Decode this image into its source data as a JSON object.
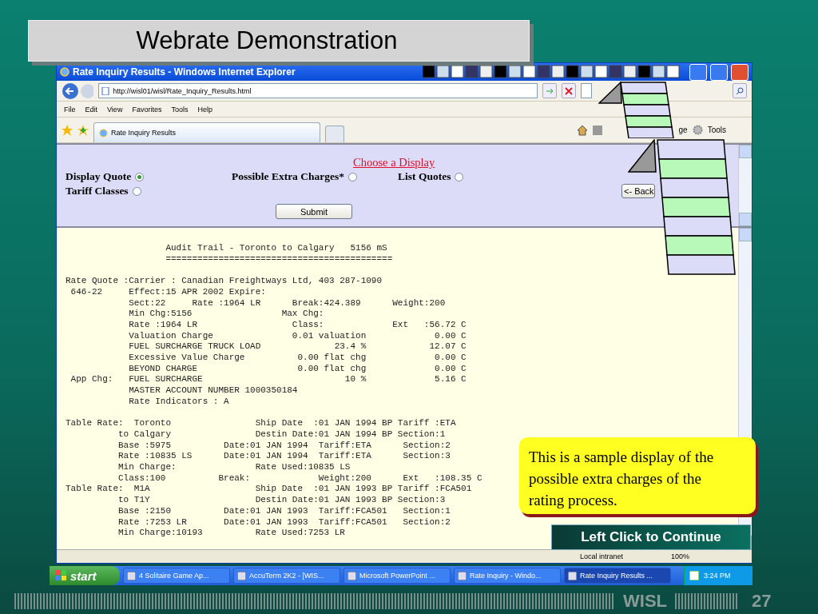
{
  "slide_title": "Webrate Demonstration",
  "browser": {
    "title": "Rate Inquiry Results - Windows Internet Explorer",
    "address": "http://wisl01/wisl/Rate_Inquiry_Results.html",
    "menu": [
      "File",
      "Edit",
      "View",
      "Favorites",
      "Tools",
      "Help"
    ],
    "tab": "Rate Inquiry Results",
    "page_menu": "ge",
    "tools_menu": "Tools",
    "status": [
      "Local intranet",
      "100%"
    ]
  },
  "display_form": {
    "heading": "Choose a Display",
    "options": [
      {
        "label": "Display Quote",
        "selected": true
      },
      {
        "label": "Possible Extra Charges*",
        "selected": false
      },
      {
        "label": "List Quotes",
        "selected": false
      },
      {
        "label": "Tariff Classes",
        "selected": false
      }
    ],
    "submit": "Submit",
    "back": "<- Back"
  },
  "audit_blocks": [
    [
      "                   Audit Trail - Toronto to Calgary   5156 mS",
      "                   ==========================================="
    ],
    [
      "Rate Quote :Carrier : Canadian Freightways Ltd, 403 287-1090",
      " 646-22     Effect:15 APR 2002 Expire:",
      "            Sect:22     Rate :1964 LR      Break:424.389      Weight:200",
      "            Min Chg:5156                 Max Chg:",
      "            Rate :1964 LR                  Class:             Ext   :56.72 C",
      "            Valuation Charge               0.01 valuation             0.00 C",
      "            FUEL SURCHARGE TRUCK LOAD              23.4 %            12.07 C",
      "            Excessive Value Charge          0.00 flat chg             0.00 C",
      "            BEYOND CHARGE                   0.00 flat chg             0.00 C",
      " App Chg:   FUEL SURCHARGE                           10 %             5.16 C",
      "            MASTER ACCOUNT NUMBER 1000350184",
      "            Rate Indicators : A"
    ],
    [
      "Table Rate:  Toronto                Ship Date  :01 JAN 1994 BP Tariff :ETA",
      "          to Calgary                Destin Date:01 JAN 1994 BP Section:1",
      "          Base :5975          Date:01 JAN 1994  Tariff:ETA      Section:2",
      "          Rate :10835 LS      Date:01 JAN 1994  Tariff:ETA      Section:3",
      "          Min Charge:               Rate Used:10835 LS",
      "          Class:100          Break:             Weight:200      Ext   :108.35 C",
      "Table Rate:  M1A                    Ship Date  :01 JAN 1993 BP Tariff :FCA501",
      "          to T1Y                    Destin Date:01 JAN 1993 BP Section:3",
      "          Base :2150          Date:01 JAN 1993  Tariff:FCA501   Section:1",
      "          Rate :7253 LR       Date:01 JAN 1993  Tariff:FCA501   Section:2",
      "          Min Charge:10193          Rate Used:7253 LR"
    ]
  ],
  "callout": "This is a sample display of the possible extra charges of the rating process.",
  "continue_button": "Left Click to Continue",
  "taskbar": {
    "start": "start",
    "tasks": [
      {
        "label": "4 Solitaire Game Ap...",
        "selected": false
      },
      {
        "label": "AccuTerm 2K2 - [WIS...",
        "selected": false
      },
      {
        "label": "Microsoft PowerPoint ...",
        "selected": false
      },
      {
        "label": "Rate Inquiry - Windo...",
        "selected": false
      },
      {
        "label": "Rate Inquiry Results ...",
        "selected": true
      }
    ],
    "clock": "3:24 PM"
  },
  "footer": {
    "brand": "WISL",
    "page_number": "27"
  }
}
